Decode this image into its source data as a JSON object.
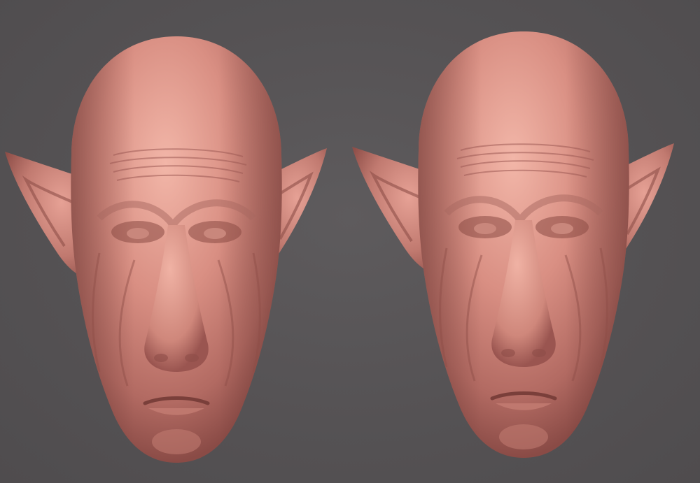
{
  "viewport": {
    "background_color": "#555254"
  },
  "models": [
    {
      "id": "left",
      "subject": "bald-goblin-head-sculpt",
      "material_color": "#d4897f",
      "highlight_color": "#f0b3a6",
      "shadow_color": "#8e4d48"
    },
    {
      "id": "right",
      "subject": "bald-goblin-head-sculpt",
      "material_color": "#d4897f",
      "highlight_color": "#f0b3a6",
      "shadow_color": "#8e4d48"
    }
  ]
}
